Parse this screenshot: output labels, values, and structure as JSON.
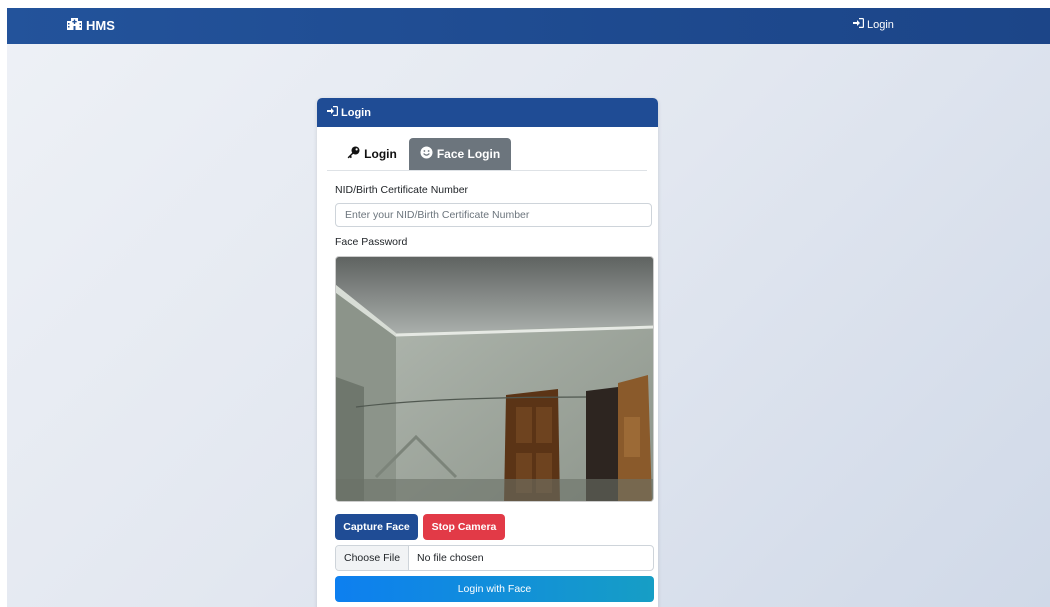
{
  "navbar": {
    "brand_icon": "hospital-icon",
    "brand": "HMS",
    "login_icon": "sign-in-icon",
    "login": "Login"
  },
  "card": {
    "header_icon": "sign-in-icon",
    "header": "Login",
    "tabs": [
      {
        "icon": "key-icon",
        "label": "Login",
        "active": false
      },
      {
        "icon": "smile-icon",
        "label": "Face Login",
        "active": true
      }
    ],
    "nid_label": "NID/Birth Certificate Number",
    "nid_placeholder": "Enter your NID/Birth Certificate Number",
    "face_label": "Face Password",
    "capture_button": "Capture Face",
    "stop_button": "Stop Camera",
    "file_button": "Choose File",
    "file_status": "No file chosen",
    "submit_button": "Login with Face"
  },
  "colors": {
    "primary": "#1f4c95",
    "danger": "#e23a47",
    "secondary": "#6c757d",
    "gradient_start": "#0d7ff0",
    "gradient_end": "#169ec5"
  }
}
